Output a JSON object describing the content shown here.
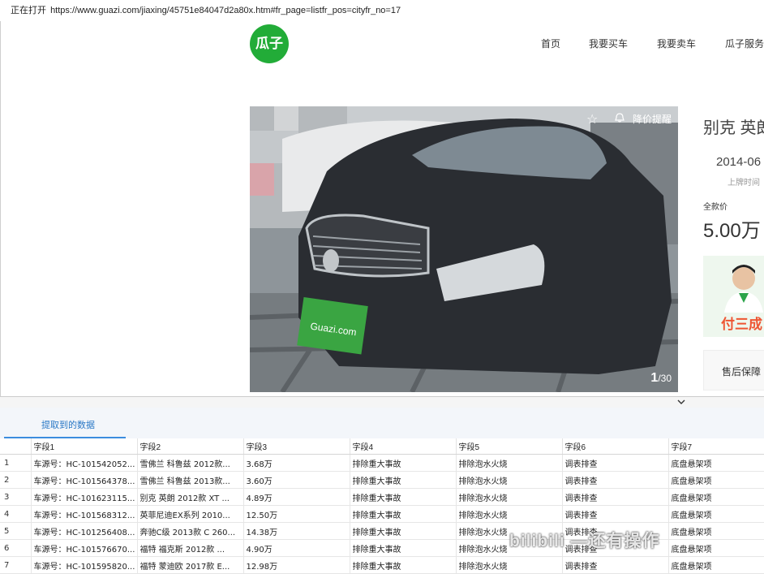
{
  "address_bar": {
    "label": "正在打开",
    "url": "https://www.guazi.com/jiaxing/45751e84047d2a80x.htm#fr_page=listfr_pos=cityfr_no=17"
  },
  "site": {
    "logo_text": "瓜子",
    "nav": [
      "首页",
      "我要买车",
      "我要卖车",
      "瓜子服务"
    ],
    "brand_color": "#22ac38"
  },
  "listing": {
    "favorite_icon": "star-icon",
    "price_alert_label": "降价提醒",
    "photo_counter_current": "1",
    "photo_counter_total": "/30",
    "title": "别克 英朗",
    "reg_date": "2014-06",
    "reg_date_label": "上牌时间",
    "price_label": "全款价",
    "price": "5.00万",
    "promo_text": "付三成",
    "service_label": "售后保障"
  },
  "data_panel": {
    "tab_label": "提取到的数据",
    "columns": [
      "",
      "字段1",
      "字段2",
      "字段3",
      "字段4",
      "字段5",
      "字段6",
      "字段7"
    ],
    "rows": [
      [
        "1",
        "车源号：HC-101542052...",
        "雪佛兰 科鲁兹 2012款...",
        "3.68万",
        "排除重大事故",
        "排除泡水火烧",
        "调表排查",
        "底盘悬架项"
      ],
      [
        "2",
        "车源号：HC-101564378...",
        "雪佛兰 科鲁兹 2013款...",
        "3.60万",
        "排除重大事故",
        "排除泡水火烧",
        "调表排查",
        "底盘悬架项"
      ],
      [
        "3",
        "车源号：HC-101623115...",
        "别克 英朗 2012款 XT ...",
        "4.89万",
        "排除重大事故",
        "排除泡水火烧",
        "调表排查",
        "底盘悬架项"
      ],
      [
        "4",
        "车源号：HC-101568312...",
        "英菲尼迪EX系列 2010...",
        "12.50万",
        "排除重大事故",
        "排除泡水火烧",
        "调表排查",
        "底盘悬架项"
      ],
      [
        "5",
        "车源号：HC-101256408...",
        "奔驰C级 2013款 C 260...",
        "14.38万",
        "排除重大事故",
        "排除泡水火烧",
        "调表排查",
        "底盘悬架项"
      ],
      [
        "6",
        "车源号：HC-101576670...",
        "福特 福克斯 2012款 ...",
        "4.90万",
        "排除重大事故",
        "排除泡水火烧",
        "调表排查",
        "底盘悬架项"
      ],
      [
        "7",
        "车源号：HC-101595820...",
        "福特 蒙迪欧 2017款 E...",
        "12.98万",
        "排除重大事故",
        "排除泡水火烧",
        "调表排查",
        "底盘悬架项"
      ]
    ]
  },
  "watermark": "bilibili —还有操作"
}
